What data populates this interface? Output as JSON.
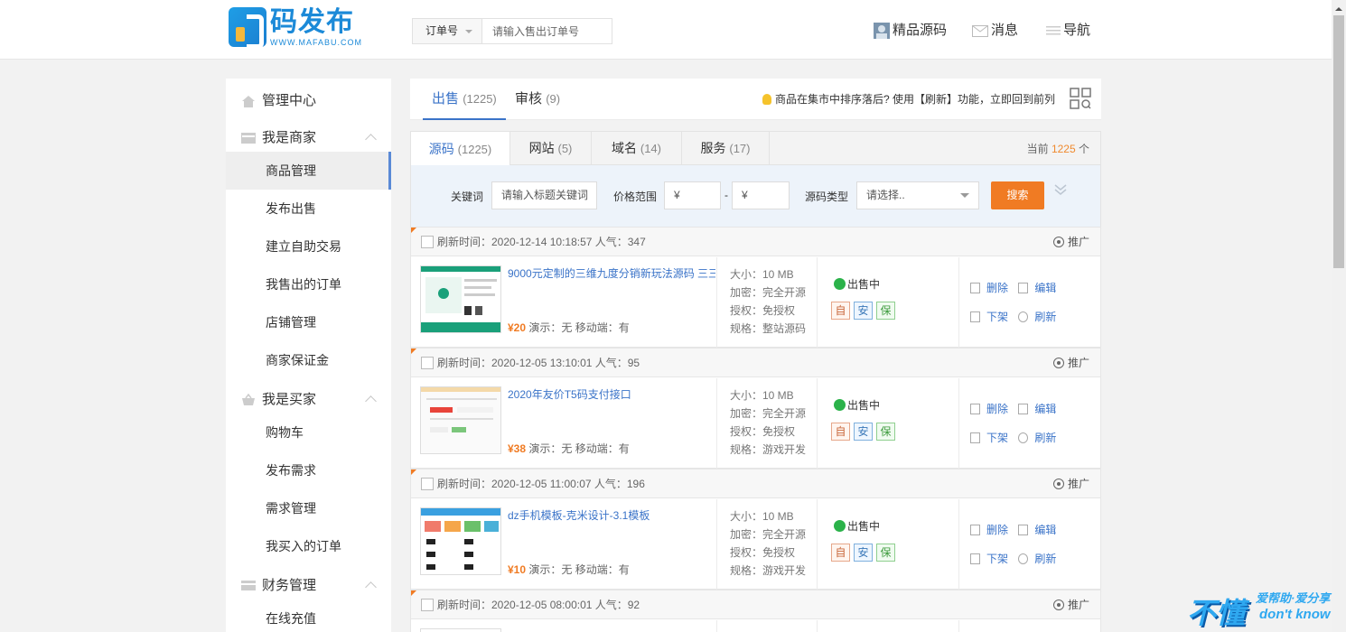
{
  "header": {
    "logo_text": "码发布",
    "logo_sub": "WWW.MAFABU.COM",
    "search_select": "订单号",
    "search_placeholder": "请输入售出订单号",
    "nav": [
      {
        "label": "精品源码",
        "icon": "avatar-icon"
      },
      {
        "label": "消息",
        "icon": "mail-icon"
      },
      {
        "label": "导航",
        "icon": "menu-icon"
      }
    ]
  },
  "sidebar": {
    "title": "管理中心",
    "groups": [
      {
        "label": "我是商家",
        "items": [
          "商品管理",
          "发布出售",
          "建立自助交易",
          "我售出的订单",
          "店铺管理",
          "商家保证金"
        ]
      },
      {
        "label": "我是买家",
        "items": [
          "购物车",
          "发布需求",
          "需求管理",
          "我买入的订单"
        ]
      },
      {
        "label": "财务管理",
        "items": [
          "在线充值"
        ]
      }
    ]
  },
  "tabs": [
    {
      "label": "出售",
      "count": "(1225)"
    },
    {
      "label": "审核",
      "count": "(9)"
    }
  ],
  "tip": "商品在集市中排序落后? 使用【刷新】功能，立即回到前列",
  "subtabs": [
    {
      "label": "源码",
      "count": "(1225)"
    },
    {
      "label": "网站",
      "count": "(5)"
    },
    {
      "label": "域名",
      "count": "(14)"
    },
    {
      "label": "服务",
      "count": "(17)"
    }
  ],
  "total": {
    "prefix": "当前",
    "value": "1225",
    "suffix": "个"
  },
  "filter": {
    "keyword_label": "关键词",
    "keyword_placeholder": "请输入标题关键词",
    "price_label": "价格范围",
    "price_min": "¥",
    "price_sep": "-",
    "price_max": "¥",
    "type_label": "源码类型",
    "type_value": "请选择..",
    "search_button": "搜索"
  },
  "items": [
    {
      "refresh": "刷新时间：2020-12-14 10:18:57   人气：347",
      "promo": "推广",
      "title": "9000元定制的三维九度分销新玩法源码 三三",
      "price": "¥20",
      "meta": " 演示：无 移动端：有",
      "specs": [
        "大小：10 MB",
        "加密：完全开源",
        "授权：免授权",
        "规格：整站源码"
      ],
      "status": "出售中",
      "badges": [
        "自",
        "安",
        "保"
      ],
      "actions": [
        "删除",
        "编辑",
        "下架",
        "刷新"
      ]
    },
    {
      "refresh": "刷新时间：2020-12-05 13:10:01   人气：95",
      "promo": "推广",
      "title": "2020年友价T5码支付接口",
      "price": "¥38",
      "meta": " 演示：无 移动端：有",
      "specs": [
        "大小：10 MB",
        "加密：完全开源",
        "授权：免授权",
        "规格：游戏开发"
      ],
      "status": "出售中",
      "badges": [
        "自",
        "安",
        "保"
      ],
      "actions": [
        "删除",
        "编辑",
        "下架",
        "刷新"
      ]
    },
    {
      "refresh": "刷新时间：2020-12-05 11:00:07   人气：196",
      "promo": "推广",
      "title": "dz手机模板-克米设计-3.1模板",
      "price": "¥10",
      "meta": " 演示：无 移动端：有",
      "specs": [
        "大小：10 MB",
        "加密：完全开源",
        "授权：免授权",
        "规格：游戏开发"
      ],
      "status": "出售中",
      "badges": [
        "自",
        "安",
        "保"
      ],
      "actions": [
        "删除",
        "编辑",
        "下架",
        "刷新"
      ]
    },
    {
      "refresh": "刷新时间：2020-12-05 08:00:01   人气：92",
      "promo": "推广"
    }
  ],
  "watermark": {
    "big": "不懂",
    "top": "爱帮助·爱分享",
    "bottom": "don't know"
  }
}
